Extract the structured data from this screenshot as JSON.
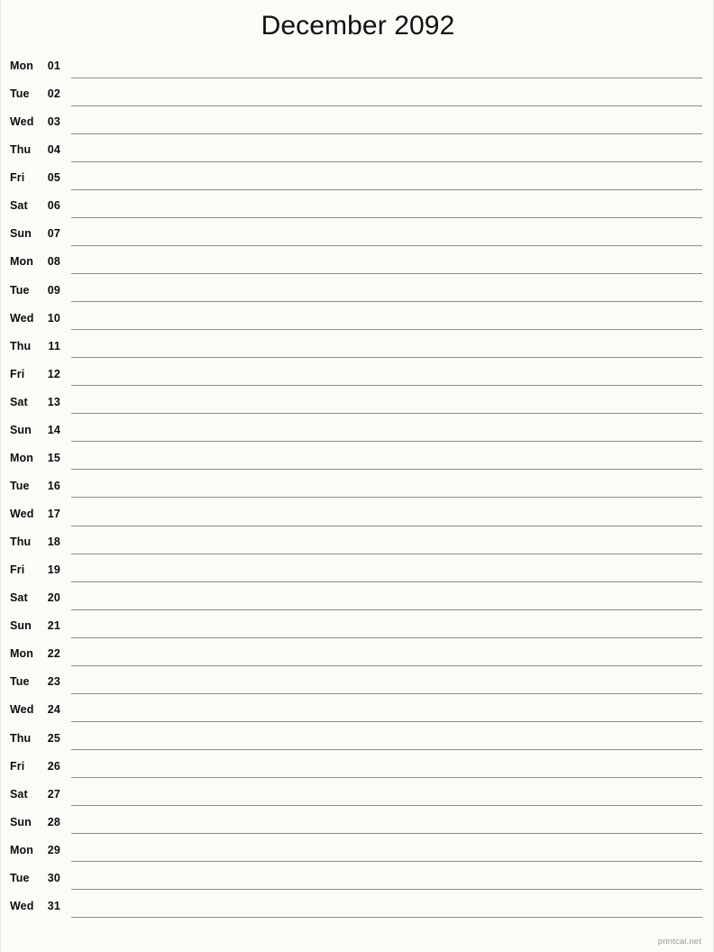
{
  "header": {
    "title": "December 2092"
  },
  "calendar": {
    "month": "December",
    "year": "2092",
    "columns": [
      "weekday",
      "day",
      "notes"
    ],
    "days": [
      {
        "weekday": "Mon",
        "day": "01"
      },
      {
        "weekday": "Tue",
        "day": "02"
      },
      {
        "weekday": "Wed",
        "day": "03"
      },
      {
        "weekday": "Thu",
        "day": "04"
      },
      {
        "weekday": "Fri",
        "day": "05"
      },
      {
        "weekday": "Sat",
        "day": "06"
      },
      {
        "weekday": "Sun",
        "day": "07"
      },
      {
        "weekday": "Mon",
        "day": "08"
      },
      {
        "weekday": "Tue",
        "day": "09"
      },
      {
        "weekday": "Wed",
        "day": "10"
      },
      {
        "weekday": "Thu",
        "day": "11"
      },
      {
        "weekday": "Fri",
        "day": "12"
      },
      {
        "weekday": "Sat",
        "day": "13"
      },
      {
        "weekday": "Sun",
        "day": "14"
      },
      {
        "weekday": "Mon",
        "day": "15"
      },
      {
        "weekday": "Tue",
        "day": "16"
      },
      {
        "weekday": "Wed",
        "day": "17"
      },
      {
        "weekday": "Thu",
        "day": "18"
      },
      {
        "weekday": "Fri",
        "day": "19"
      },
      {
        "weekday": "Sat",
        "day": "20"
      },
      {
        "weekday": "Sun",
        "day": "21"
      },
      {
        "weekday": "Mon",
        "day": "22"
      },
      {
        "weekday": "Tue",
        "day": "23"
      },
      {
        "weekday": "Wed",
        "day": "24"
      },
      {
        "weekday": "Thu",
        "day": "25"
      },
      {
        "weekday": "Fri",
        "day": "26"
      },
      {
        "weekday": "Sat",
        "day": "27"
      },
      {
        "weekday": "Sun",
        "day": "28"
      },
      {
        "weekday": "Mon",
        "day": "29"
      },
      {
        "weekday": "Tue",
        "day": "30"
      },
      {
        "weekday": "Wed",
        "day": "31"
      }
    ]
  },
  "footer": {
    "watermark": "printcal.net"
  },
  "colors": {
    "background": "#fbfcf8",
    "text": "#0d0d0d",
    "rule": "#8b8f87",
    "watermark": "#9a9a9a",
    "page_border": "#e8e8e4"
  }
}
